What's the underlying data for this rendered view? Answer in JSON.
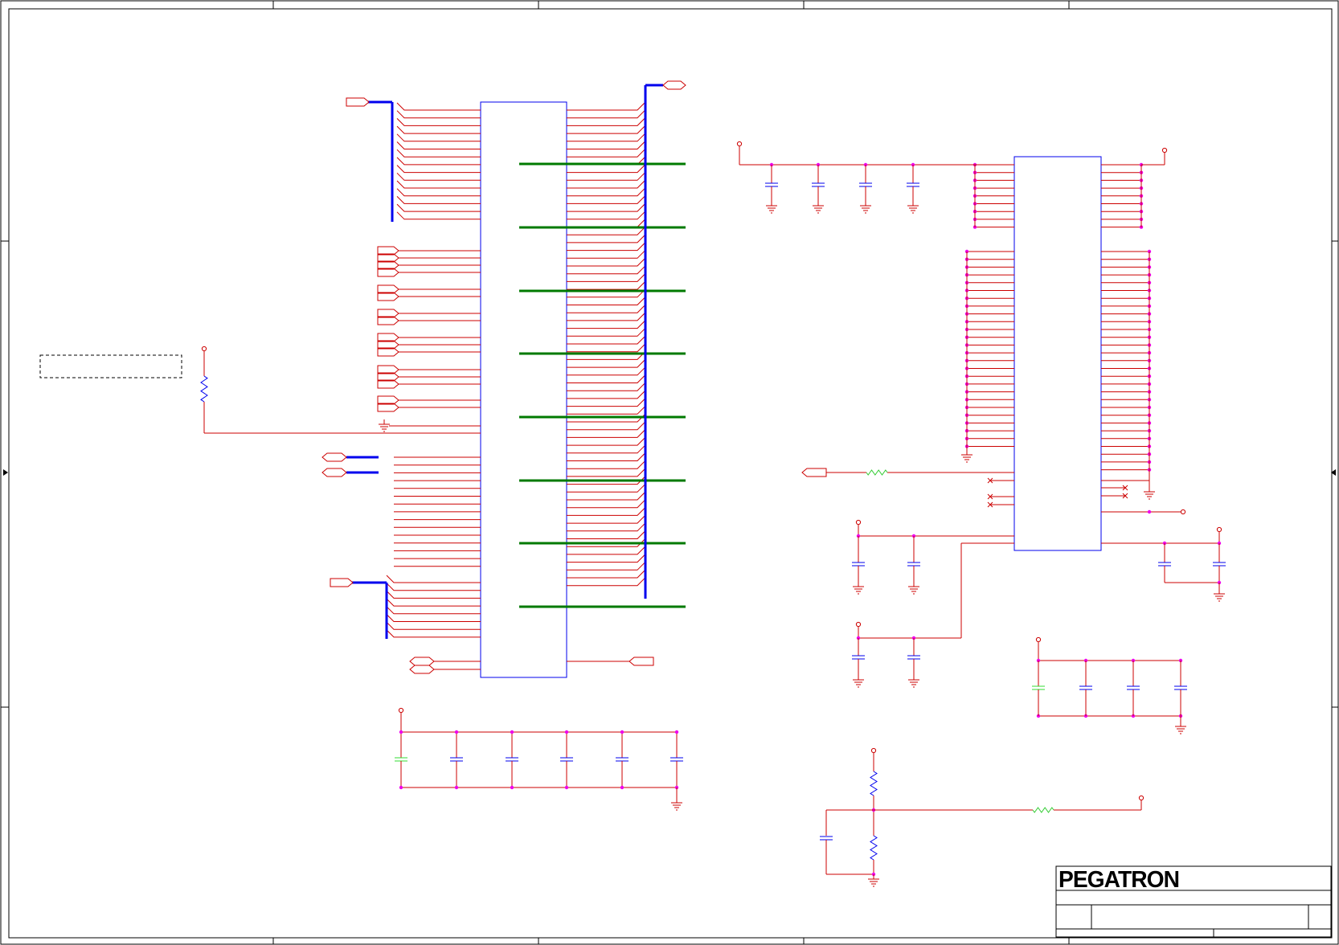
{
  "title_block": {
    "company": "PEGATRON"
  },
  "colors": {
    "wire": "#cc0000",
    "bus": "#0000ee",
    "component_outline": "#0000ee",
    "junction": "#ee00ee",
    "power_tie": "#007a00",
    "frame": "#000000",
    "capacitor_alt": "#33dd33",
    "resistor_alt": "#33cc33"
  },
  "icons": {
    "ground": "ground-icon",
    "power": "power-pin-icon",
    "port": "port-connector-icon",
    "capacitor": "capacitor-icon",
    "resistor": "resistor-icon",
    "no_connect": "no-connect-icon"
  }
}
